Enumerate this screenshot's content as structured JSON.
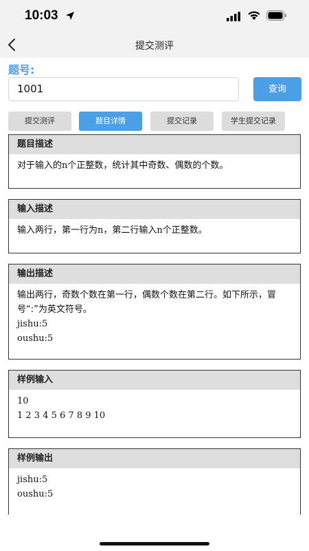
{
  "status": {
    "time": "10:03"
  },
  "nav": {
    "title": "提交测评"
  },
  "query": {
    "label": "题号:",
    "value": "1001",
    "button": "查询"
  },
  "tabs": [
    {
      "label": "提交测评",
      "active": false
    },
    {
      "label": "题目详情",
      "active": true
    },
    {
      "label": "提交记录",
      "active": false
    },
    {
      "label": "学生提交记录",
      "active": false
    }
  ],
  "sections": {
    "description": {
      "title": "题目描述",
      "lines": [
        "对于输入的n个正整数，统计其中奇数、偶数的个数。"
      ]
    },
    "input": {
      "title": "输入描述",
      "lines": [
        "输入两行，第一行为n，第二行输入n个正整数。"
      ]
    },
    "output": {
      "title": "输出描述",
      "lines": [
        "输出两行，奇数个数在第一行，偶数个数在第二行。如下所示，冒号“:”为英文符号。",
        "jishu:5",
        "oushu:5"
      ]
    },
    "sample_input": {
      "title": "样例输入",
      "lines": [
        "10",
        "1 2 3 4 5 6 7 8 9 10"
      ]
    },
    "sample_output": {
      "title": "样例输出",
      "lines": [
        "jishu:5",
        "oushu:5"
      ]
    }
  },
  "colors": {
    "accent": "#4a9fe6",
    "tab_inactive": "#dcdcdc",
    "section_header": "#dedede"
  }
}
